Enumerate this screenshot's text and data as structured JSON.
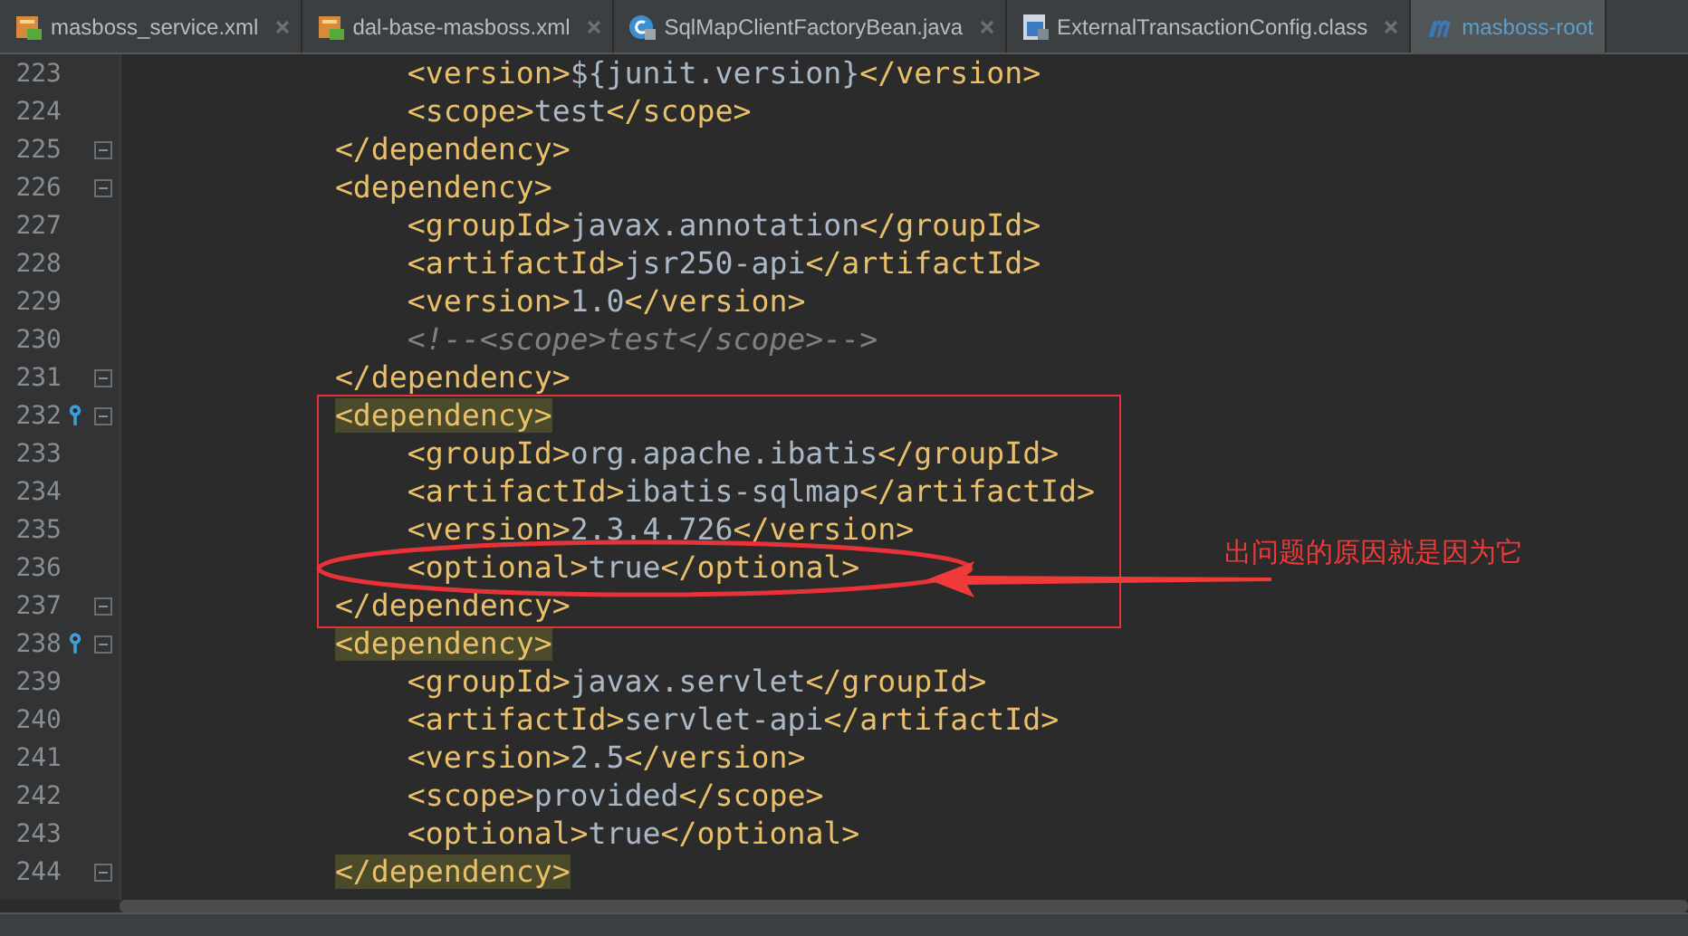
{
  "tabs": [
    {
      "label": "masboss_service.xml",
      "kind": "xml",
      "selected": false,
      "closable": true
    },
    {
      "label": "dal-base-masboss.xml",
      "kind": "xml",
      "selected": false,
      "closable": true
    },
    {
      "label": "SqlMapClientFactoryBean.java",
      "kind": "class",
      "selected": false,
      "closable": true
    },
    {
      "label": "ExternalTransactionConfig.class",
      "kind": "binary",
      "selected": false,
      "closable": true
    },
    {
      "label": "masboss-root",
      "kind": "maven",
      "selected": true,
      "closable": false
    }
  ],
  "editor": {
    "lines": [
      {
        "number": "223",
        "text": "            <version>${junit.version}</version>",
        "fold": false,
        "marker": false,
        "highlight": false
      },
      {
        "number": "224",
        "text": "            <scope>test</scope>",
        "fold": false,
        "marker": false,
        "highlight": false
      },
      {
        "number": "225",
        "text": "        </dependency>",
        "fold": true,
        "marker": false,
        "highlight": false
      },
      {
        "number": "226",
        "text": "        <dependency>",
        "fold": true,
        "marker": false,
        "highlight": false
      },
      {
        "number": "227",
        "text": "            <groupId>javax.annotation</groupId>",
        "fold": false,
        "marker": false,
        "highlight": false
      },
      {
        "number": "228",
        "text": "            <artifactId>jsr250-api</artifactId>",
        "fold": false,
        "marker": false,
        "highlight": false
      },
      {
        "number": "229",
        "text": "            <version>1.0</version>",
        "fold": false,
        "marker": false,
        "highlight": false
      },
      {
        "number": "230",
        "text": "            <!--<scope>test</scope>-->",
        "fold": false,
        "marker": false,
        "highlight": false
      },
      {
        "number": "231",
        "text": "        </dependency>",
        "fold": true,
        "marker": false,
        "highlight": false
      },
      {
        "number": "232",
        "text": "        <dependency>",
        "fold": true,
        "marker": true,
        "highlight": true
      },
      {
        "number": "233",
        "text": "            <groupId>org.apache.ibatis</groupId>",
        "fold": false,
        "marker": false,
        "highlight": false
      },
      {
        "number": "234",
        "text": "            <artifactId>ibatis-sqlmap</artifactId>",
        "fold": false,
        "marker": false,
        "highlight": false
      },
      {
        "number": "235",
        "text": "            <version>2.3.4.726</version>",
        "fold": false,
        "marker": false,
        "highlight": false
      },
      {
        "number": "236",
        "text": "            <optional>true</optional>",
        "fold": false,
        "marker": false,
        "highlight": false
      },
      {
        "number": "237",
        "text": "        </dependency>",
        "fold": true,
        "marker": false,
        "highlight": false
      },
      {
        "number": "238",
        "text": "        <dependency>",
        "fold": true,
        "marker": true,
        "highlight": true
      },
      {
        "number": "239",
        "text": "            <groupId>javax.servlet</groupId>",
        "fold": false,
        "marker": false,
        "highlight": false
      },
      {
        "number": "240",
        "text": "            <artifactId>servlet-api</artifactId>",
        "fold": false,
        "marker": false,
        "highlight": false
      },
      {
        "number": "241",
        "text": "            <version>2.5</version>",
        "fold": false,
        "marker": false,
        "highlight": false
      },
      {
        "number": "242",
        "text": "            <scope>provided</scope>",
        "fold": false,
        "marker": false,
        "highlight": false
      },
      {
        "number": "243",
        "text": "            <optional>true</optional>",
        "fold": false,
        "marker": false,
        "highlight": false
      },
      {
        "number": "244",
        "text": "        </dependency>",
        "fold": true,
        "marker": false,
        "highlight": true
      }
    ]
  },
  "annotation": {
    "note": "出问题的原因就是因为它"
  }
}
